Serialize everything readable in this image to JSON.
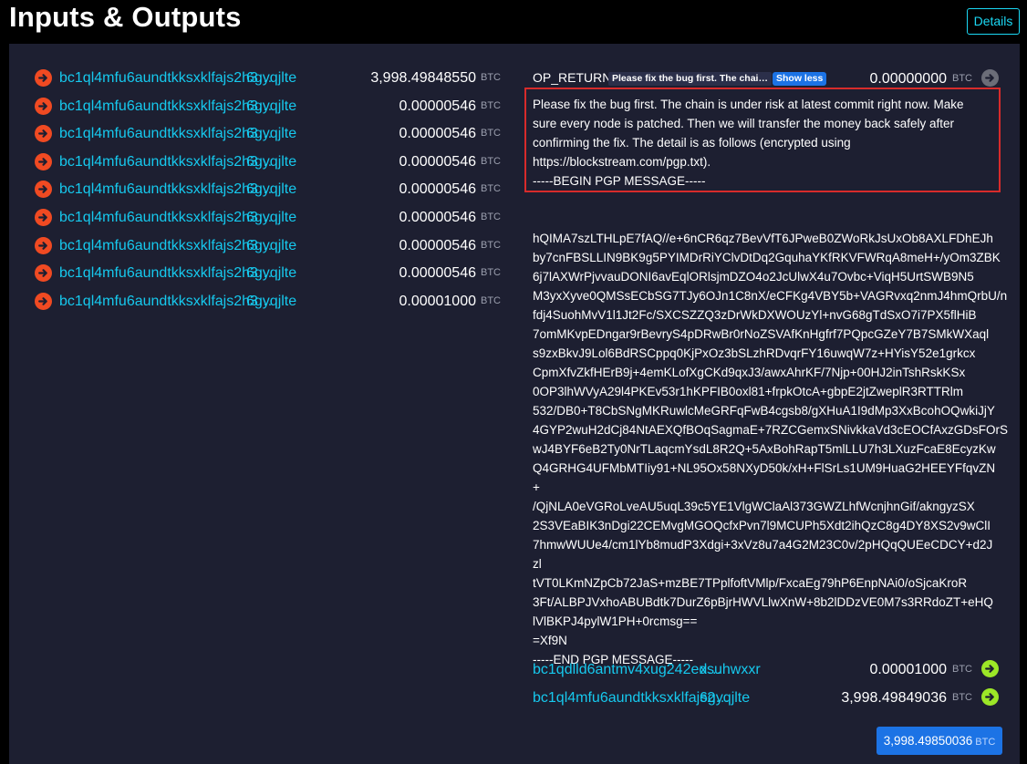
{
  "header": {
    "title": "Inputs & Outputs",
    "details_label": "Details"
  },
  "inputs": [
    {
      "addr": "bc1ql4mfu6aundtkksxklfajs2h3…",
      "tail": "6gyqjlte",
      "amount": "3,998.49848550",
      "unit": "BTC"
    },
    {
      "addr": "bc1ql4mfu6aundtkksxklfajs2h3…",
      "tail": "6gyqjlte",
      "amount": "0.00000546",
      "unit": "BTC"
    },
    {
      "addr": "bc1ql4mfu6aundtkksxklfajs2h3…",
      "tail": "6gyqjlte",
      "amount": "0.00000546",
      "unit": "BTC"
    },
    {
      "addr": "bc1ql4mfu6aundtkksxklfajs2h3…",
      "tail": "6gyqjlte",
      "amount": "0.00000546",
      "unit": "BTC"
    },
    {
      "addr": "bc1ql4mfu6aundtkksxklfajs2h3…",
      "tail": "6gyqjlte",
      "amount": "0.00000546",
      "unit": "BTC"
    },
    {
      "addr": "bc1ql4mfu6aundtkksxklfajs2h3…",
      "tail": "6gyqjlte",
      "amount": "0.00000546",
      "unit": "BTC"
    },
    {
      "addr": "bc1ql4mfu6aundtkksxklfajs2h3…",
      "tail": "6gyqjlte",
      "amount": "0.00000546",
      "unit": "BTC"
    },
    {
      "addr": "bc1ql4mfu6aundtkksxklfajs2h3…",
      "tail": "6gyqjlte",
      "amount": "0.00000546",
      "unit": "BTC"
    },
    {
      "addr": "bc1ql4mfu6aundtkksxklfajs2h3…",
      "tail": "6gyqjlte",
      "amount": "0.00001000",
      "unit": "BTC"
    }
  ],
  "op_return": {
    "label": "OP_RETURN",
    "preview": "Please fix the bug first. The chai…",
    "show_less_label": "Show less",
    "amount": "0.00000000",
    "unit": "BTC",
    "message_lines": [
      "Please fix the bug first. The chain is under risk at latest commit right now. Make",
      "sure every node is patched. Then we will transfer the money back safely after",
      "confirming the fix. The detail is as follows (encrypted using",
      "https://blockstream.com/pgp.txt).",
      "-----BEGIN PGP MESSAGE-----"
    ],
    "pgp_lines": [
      "",
      "hQIMA7szLTHLpE7fAQ//e+6nCR6qz7BevVfT6JPweB0ZWoRkJsUxOb8AXLFDhEJh",
      "by7cnFBSLLIN9BK9g5PYIMDrRiYClvDtDq2GquhaYKfRKVFWRqA8meH+/yOm3ZBK",
      "6j7lAXWrPjvvauDONI6avEqlORlsjmDZO4o2JcUlwX4u7Ovbc+ViqH5UrtSWB9N5",
      "M3yxXyve0QMSsECbSG7TJy6OJn1C8nX/eCFKg4VBY5b+VAGRvxq2nmJ4hmQrbU/n",
      "fdj4SuohMvV1l1Jt2Fc/SXCSZZQ3zDrWkDXWOUzYl+nvG68gTdSxO7i7PX5flHiB",
      "7omMKvpEDngar9rBevryS4pDRwBr0rNoZSVAfKnHgfrf7PQpcGZeY7B7SMkWXaql",
      "s9zxBkvJ9Lol6BdRSCppq0KjPxOz3bSLzhRDvqrFY16uwqW7z+HYisY52e1grkcx",
      "CpmXfvZkfHErB9j+4emKLofXgCKd9qxJ3/awxAhrKF/7Njp+00HJ2inTshRskKSx",
      "0OP3lhWVyA29l4PKEv53r1hKPFIB0oxl81+frpkOtcA+gbpE2jtZweplR3RTTRlm",
      "532/DB0+T8CbSNgMKRuwlcMeGRFqFwB4cgsb8/gXHuA1I9dMp3XxBcohOQwkiJjY",
      "4GYP2wuH2dCj84NtAEXQfBOqSagmaE+7RZCGemxSNivkkaVd3cEOCfAxzGDsFOrS",
      "wJ4BYF6eB2Ty0NrTLaqcmYsdL8R2Q+5AxBohRapT5mlLLU7h3LXuzFcaE8EcyzKw",
      "Q4GRHG4UFMbMTIiy91+NL95Ox58NXyD50k/xH+FlSrLs1UM9HuaG2HEEYFfqvZN",
      "+",
      "/QjNLA0eVGRoLveAU5uqL39c5YE1VlgWClaAl373GWZLhfWcnjhnGif/akngyzSX",
      "2S3VEaBIK3nDgi22CEMvgMGOQcfxPvn7l9MCUPh5Xdt2ihQzC8g4DY8XS2v9wClI",
      "7hmwWUUe4/cm1lYb8mudP3Xdgi+3xVz8u7a4G2M23C0v/2pHQqQUEeCDCY+d2J",
      "zl",
      "tVT0LKmNZpCb72JaS+mzBE7TPplfoftVMlp/FxcaEg79hP6EnpNAi0/oSjcaKroR",
      "3Ft/ALBPJVxhoABUBdtk7DurZ6pBjrHWVLlwXnW+8b2lDDzVE0M7s3RRdoZT+eHQ",
      "lVlBKPJ4pylW1PH+0rcmsg==",
      "=Xf9N",
      "-----END PGP MESSAGE-----"
    ]
  },
  "outputs": [
    {
      "addr": "bc1qdlld6antmv4xug242ed…",
      "tail": "xsuhwxxr",
      "amount": "0.00001000",
      "unit": "BTC"
    },
    {
      "addr": "bc1ql4mfu6aundtkksxklfajs2…",
      "tail": "6gyqjlte",
      "amount": "3,998.49849036",
      "unit": "BTC"
    }
  ],
  "total": {
    "amount": "3,998.49850036",
    "unit": "BTC"
  },
  "colors": {
    "background": "#000000",
    "panel": "#1d1f31",
    "link": "#16c9ee",
    "input_arrow": "#f04a22",
    "output_arrow": "#9ce727",
    "accent": "#1c73e5",
    "highlight_border": "#d72b2b"
  }
}
